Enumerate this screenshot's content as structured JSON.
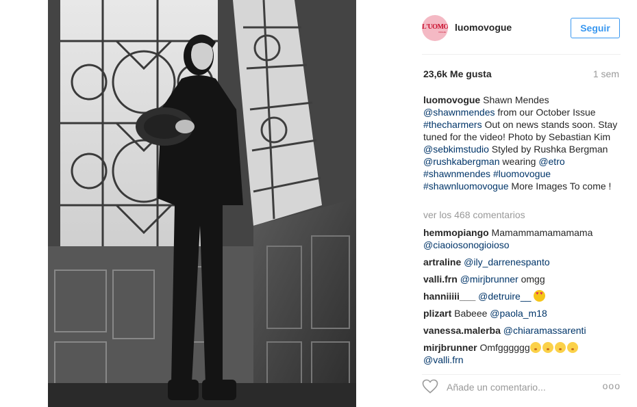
{
  "post": {
    "username": "luomovogue",
    "avatar_text": "L'UOMO",
    "avatar_sub": "VOGUE",
    "follow_label": "Seguir",
    "likes": "23,6k Me gusta",
    "time_ago": "1 sem",
    "caption": {
      "author": "luomovogue",
      "t1": " Shawn Mendes ",
      "m1": "@shawnmendes",
      "t2": " from our October Issue ",
      "h1": "#thecharmers",
      "t3": " Out on news stands soon. Stay tuned for the video! Photo by Sebastian Kim ",
      "m2": "@sebkimstudio",
      "t4": " Styled by Rushka Bergman ",
      "m3": "@rushkabergman",
      "t5": " wearing ",
      "h2": "@etro",
      "t6": " ",
      "h3": "#shawnmendes",
      "t7": " ",
      "h4": "#luomovogue",
      "t8": " ",
      "h5": "#shawnluomovogue",
      "t9": " More Images To come !"
    },
    "view_all": "ver los 468 comentarios",
    "comments": [
      {
        "author": "hemmopiango",
        "text": " Mamammamamamama ",
        "mention": "@ciaoiosonogioioso",
        "emoji": ""
      },
      {
        "author": "artraline",
        "text": " ",
        "mention": "@ily_darrenespanto",
        "emoji": ""
      },
      {
        "author": "valli.frn",
        "text": " ",
        "mention": "@mirjbrunner",
        "after": " omgg",
        "emoji": ""
      },
      {
        "author": "hanniiiii___",
        "text": " ",
        "mention": "@detruire__",
        "emoji": "heart-eyes"
      },
      {
        "author": "plizart",
        "text": " Babeee ",
        "mention": "@paola_m18",
        "emoji": ""
      },
      {
        "author": "vanessa.malerba",
        "text": " ",
        "mention": "@chiaramassarenti",
        "emoji": ""
      },
      {
        "author": "mirjbrunner",
        "text": " Omfgggggg",
        "mention": "@valli.frn",
        "emoji": "kissing-face-x4"
      }
    ],
    "add_comment_placeholder": "Añade un comentario...",
    "more_label": "ooo"
  },
  "colors": {
    "link": "#003569",
    "follow_blue": "#3897f0",
    "muted": "#999999",
    "avatar_bg": "#f4b9c4",
    "avatar_red": "#c8102e"
  },
  "icons": [
    "heart-outline-icon",
    "more-options-icon",
    "heart-eyes-emoji",
    "kissing-face-emoji"
  ]
}
